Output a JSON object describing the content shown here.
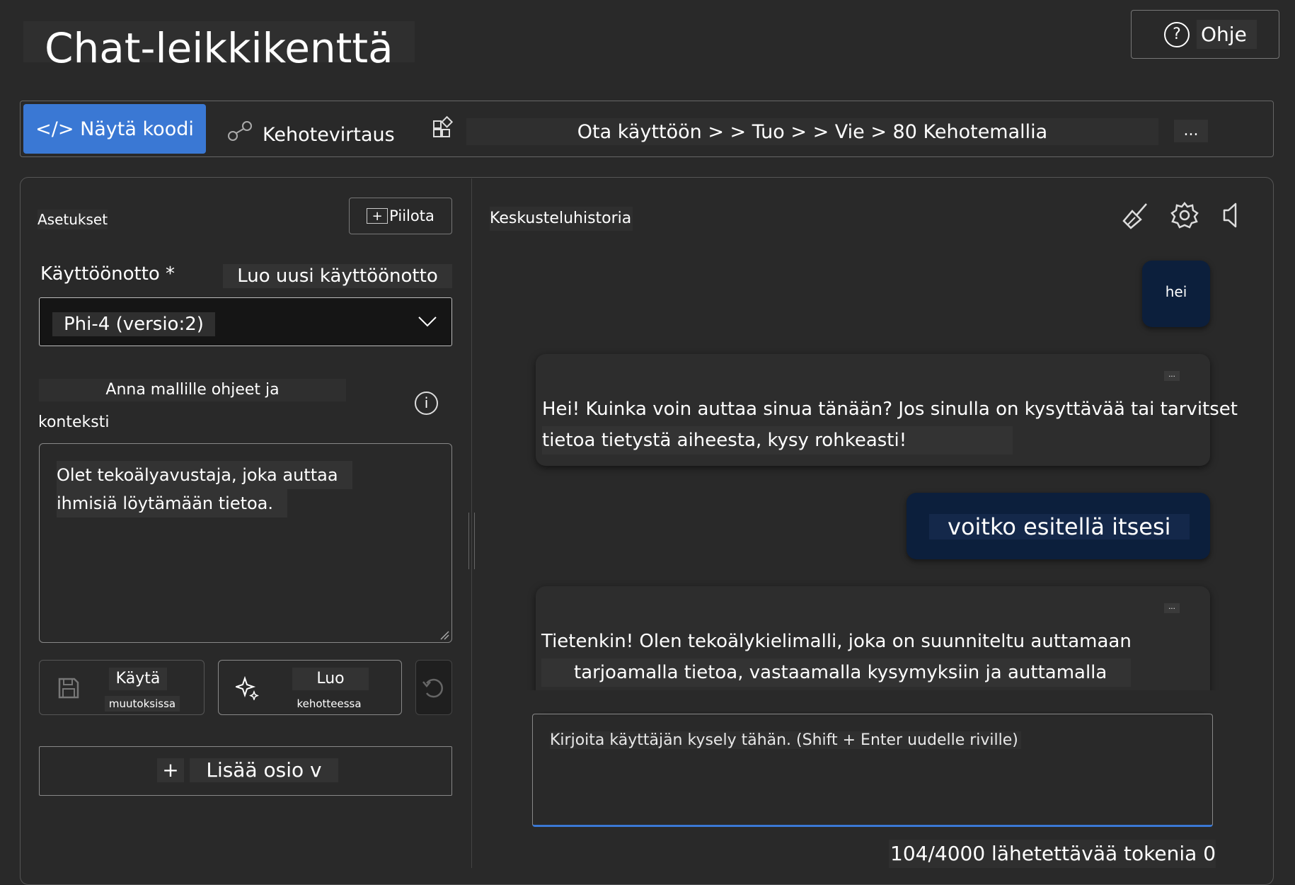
{
  "header": {
    "title": "Chat-leikkikenttä",
    "help_label": "Ohje",
    "help_icon": "?"
  },
  "toolbar": {
    "view_code_label": "</> Näytä koodi",
    "prompt_flow_label": "Kehotevirtaus",
    "breadcrumb_text": "Ota käyttöön > > Tuo > > Vie > 80 Kehotemallia",
    "more_label": "..."
  },
  "settings": {
    "title": "Asetukset",
    "hide_label": "Piilota",
    "hide_plus": "+",
    "deployment_label": "Käyttöönotto *",
    "create_deployment_label": "Luo uusi käyttöönotto",
    "deployment_value": "Phi-4 (versio:2)",
    "instructions_label_1": "Anna mallille ohjeet ja",
    "instructions_label_2": "konteksti",
    "info_icon": "i",
    "system_message_line_1": "Olet tekoälyavustaja, joka auttaa",
    "system_message_line_2": "ihmisiä löytämään tietoa.",
    "apply_label_1": "Käytä",
    "apply_label_2": "muutoksissa",
    "generate_label_1": "Luo",
    "generate_label_2": "kehotteessa",
    "add_section_plus": "+",
    "add_section_label": "Lisää osio v"
  },
  "chat": {
    "history_title": "Keskusteluhistoria",
    "messages": [
      {
        "role": "user",
        "text": "hei"
      },
      {
        "role": "assistant",
        "more": "...",
        "lines": [
          "Hei! Kuinka voin auttaa sinua tänään? Jos sinulla on kysyttävää tai tarvitset",
          "tietoa tietystä aiheesta, kysy rohkeasti!"
        ]
      },
      {
        "role": "user",
        "text": "voitko esitellä itsesi"
      },
      {
        "role": "assistant",
        "more": "...",
        "lines": [
          "Tietenkin! Olen tekoälykielimalli, joka on suunniteltu auttamaan",
          "tarjoamalla tietoa, vastaamalla kysymyksiin ja auttamalla"
        ]
      }
    ],
    "input_placeholder": "Kirjoita käyttäjän kysely tähän. (Shift + Enter uudelle riville)",
    "token_count": "104/4000 lähetettävää tokenia 0"
  },
  "colors": {
    "background": "#292929",
    "accent": "#3a78d4",
    "user_bubble": "#0c1f3c",
    "assistant_bubble": "#2d2d2d"
  },
  "icons": [
    "help-icon",
    "prompt-flow-icon",
    "apps-icon",
    "chevron-down-icon",
    "info-icon",
    "save-icon",
    "sparkle-icon",
    "undo-icon",
    "broom-icon",
    "settings-gear-icon",
    "speaker-icon"
  ]
}
